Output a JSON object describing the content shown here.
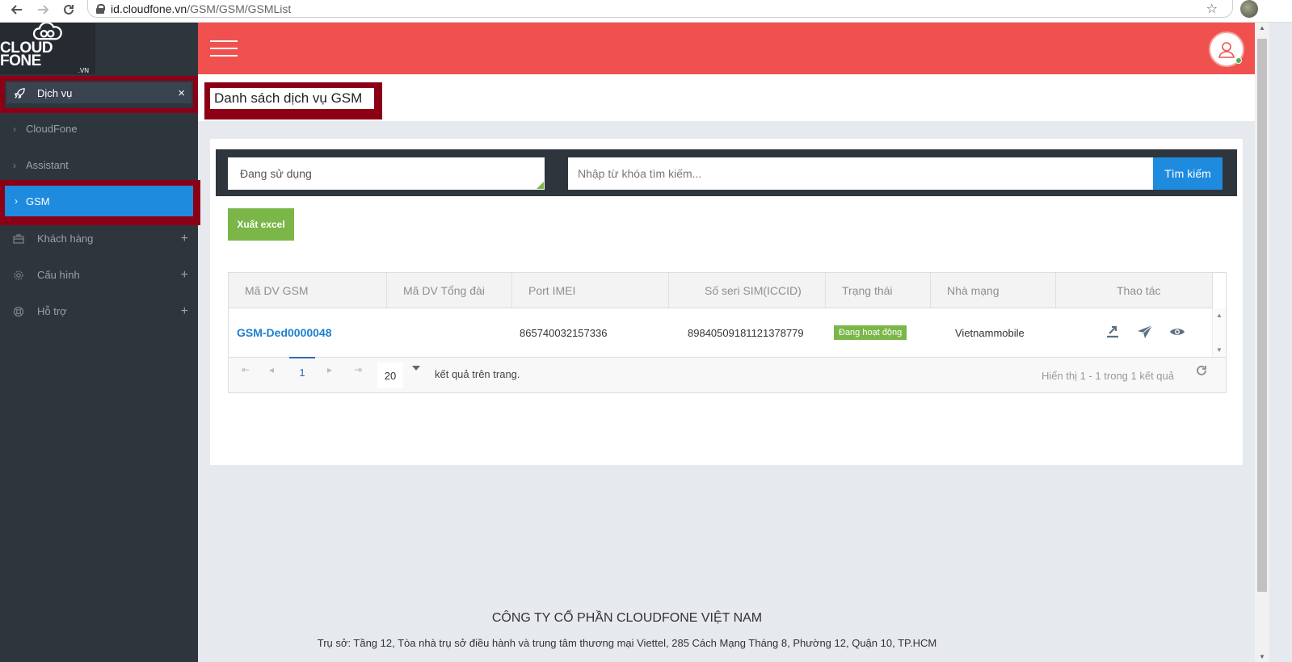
{
  "browser": {
    "url_prefix": "id.cloudfone.vn",
    "url_path": "/GSM/GSM/GSMList"
  },
  "sidebar": {
    "logo_text": "CLOUD FONE",
    "logo_sub": ".VN",
    "section_label": "Dịch vụ",
    "section_close": "×",
    "items": [
      {
        "label": "CloudFone"
      },
      {
        "label": "Assistant"
      },
      {
        "label": "GSM"
      },
      {
        "label": "Khách hàng"
      },
      {
        "label": "Cấu hình"
      },
      {
        "label": "Hỗ trợ"
      }
    ]
  },
  "header": {
    "page_title": "Danh sách dịch vụ GSM"
  },
  "filters": {
    "status_value": "Đang sử dụng",
    "search_placeholder": "Nhập từ khóa tìm kiếm...",
    "search_button": "Tìm kiếm",
    "export_button": "Xuất excel"
  },
  "table": {
    "columns": [
      "Mã DV GSM",
      "Mã DV Tổng đài",
      "Port IMEI",
      "Số seri SIM(ICCID)",
      "Trạng thái",
      "Nhà mạng",
      "Thao tác"
    ],
    "rows": [
      {
        "gsm_code": "GSM-Ded0000048",
        "switchboard_code": "",
        "port_imei": "865740032157336",
        "sim_serial": "89840509181121378779",
        "status": "Đang hoạt động",
        "carrier": "Vietnammobile"
      }
    ]
  },
  "pager": {
    "current_page": "1",
    "page_size": "20",
    "per_page_label": "kết quả trên trang.",
    "summary": "Hiển thị 1 - 1 trong 1 kết quả"
  },
  "footer": {
    "company": "CÔNG TY CỔ PHẦN CLOUDFONE VIỆT NAM",
    "address": "Trụ sở: Tầng 12, Tòa nhà trụ sở điều hành và trung tâm thương mại Viettel, 285 Cách Mạng Tháng 8, Phường 12, Quận 10, TP.HCM"
  },
  "colors": {
    "topbar": "#f0514f",
    "sidebar": "#2f353d",
    "active_item": "#1e8bdf",
    "highlight_frame": "#8c0016",
    "success": "#7ab648"
  }
}
